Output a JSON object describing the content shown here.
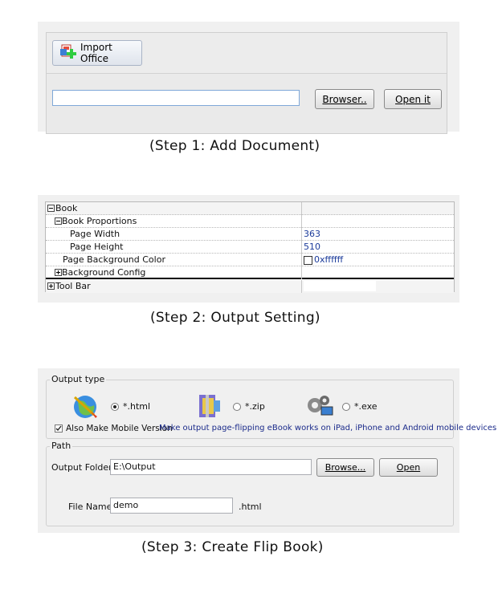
{
  "step1": {
    "import_label": "Import Office",
    "path_value": "",
    "browser_label": "Browser..",
    "openit_label": "Open it",
    "caption": "(Step 1: Add Document)"
  },
  "step2": {
    "rows": [
      {
        "key": "Book",
        "value": ""
      },
      {
        "key": "Book Proportions",
        "value": ""
      },
      {
        "key": "Page Width",
        "value": "363"
      },
      {
        "key": "Page Height",
        "value": "510"
      },
      {
        "key": "Page Background Color",
        "value": "0xffffff"
      },
      {
        "key": "Background Config",
        "value": ""
      },
      {
        "key": "Tool Bar",
        "value": ""
      }
    ],
    "caption": "(Step 2: Output Setting)"
  },
  "step3": {
    "output_type_title": "Output type",
    "opt_html": "*.html",
    "opt_zip": "*.zip",
    "opt_exe": "*.exe",
    "selected": "html",
    "mobile_label": "Also Make Mobile Version",
    "mobile_checked": true,
    "mobile_note": "Make output page-flipping eBook works on iPad, iPhone and Android mobile devices",
    "path_title": "Path",
    "output_folder_label": "Output Folder:",
    "output_folder_value": "E:\\Output",
    "browse_label": "Browse...",
    "open_label": "Open",
    "file_name_label": "File Name:",
    "file_name_value": "demo",
    "file_ext": ".html",
    "caption": "(Step 3: Create Flip Book)"
  },
  "colors": {
    "panel": "#f0f0f0",
    "value_text": "#1a3a9a",
    "note_text": "#1a2a8a",
    "input_border": "#7fa8d8"
  }
}
